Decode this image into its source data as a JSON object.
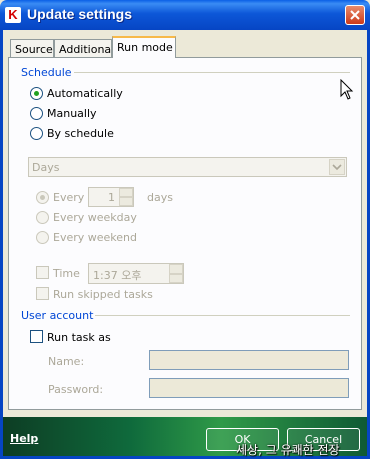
{
  "window": {
    "title": "Update settings",
    "app_icon_letter": "K"
  },
  "tabs": [
    {
      "label": "Source",
      "active": false
    },
    {
      "label": "Additional",
      "active": false
    },
    {
      "label": "Run mode",
      "active": true
    }
  ],
  "schedule": {
    "group_label": "Schedule",
    "options": [
      {
        "label": "Automatically",
        "selected": true
      },
      {
        "label": "Manually",
        "selected": false
      },
      {
        "label": "By schedule",
        "selected": false
      }
    ],
    "period_select": {
      "value": "Days"
    },
    "every": {
      "label": "Every",
      "value": "1",
      "unit": "days",
      "selected": true
    },
    "every_weekday": {
      "label": "Every weekday"
    },
    "every_weekend": {
      "label": "Every weekend"
    },
    "time": {
      "label": "Time",
      "value": "1:37 오후",
      "checked": false
    },
    "run_skipped": {
      "label": "Run skipped tasks",
      "checked": false
    }
  },
  "user_account": {
    "group_label": "User account",
    "run_task_as": {
      "label": "Run task as",
      "checked": false
    },
    "name_label": "Name:",
    "name_value": "",
    "password_label": "Password:",
    "password_value": ""
  },
  "footer": {
    "help_label": "Help",
    "ok_label": "OK",
    "cancel_label": "Cancel",
    "watermark": "세상, 그 유쾌한 전장"
  }
}
